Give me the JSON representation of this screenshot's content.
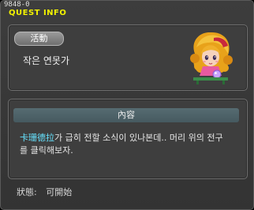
{
  "title_bar": {
    "quest_id": "9848-0",
    "title": "QUEST INFO"
  },
  "quest": {
    "category": "活動",
    "name": "작은 연못가",
    "npc_portrait_icon": "npc-girl-portrait-icon"
  },
  "content": {
    "header": "內容",
    "npc_name": "卡珊德拉",
    "line1_rest": "가 급히 전할 소식이 있나본데.. 머리 위의 전구",
    "line2": "를 클릭해보자."
  },
  "status": {
    "label": "狀態:",
    "value": "可開始"
  },
  "colors": {
    "title": "#f2f200",
    "npc_highlight": "#66e3ff",
    "panel_bg": "#3e3e3e",
    "window_bg": "#383838"
  }
}
